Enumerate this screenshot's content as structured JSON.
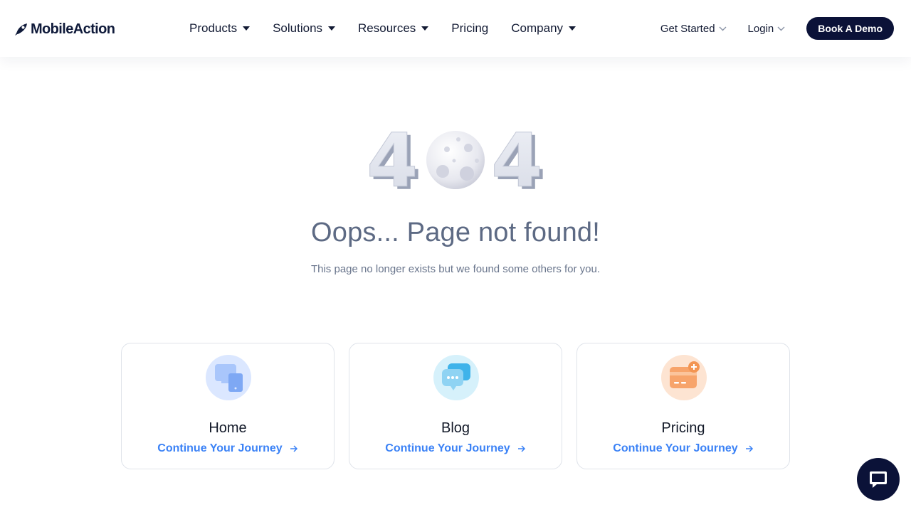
{
  "brand": {
    "name": "MobileAction"
  },
  "nav": {
    "items": [
      {
        "label": "Products",
        "has_dropdown": true
      },
      {
        "label": "Solutions",
        "has_dropdown": true
      },
      {
        "label": "Resources",
        "has_dropdown": true
      },
      {
        "label": "Pricing",
        "has_dropdown": false
      },
      {
        "label": "Company",
        "has_dropdown": true
      }
    ],
    "get_started": "Get Started",
    "login": "Login",
    "book_demo": "Book A Demo"
  },
  "error": {
    "code_left": "4",
    "code_right": "4",
    "title": "Oops... Page not found!",
    "message": "This page no longer exists but we found some others for you."
  },
  "cards": [
    {
      "title": "Home",
      "link": "Continue Your Journey",
      "icon": "devices-icon",
      "color": "#dbe7ff"
    },
    {
      "title": "Blog",
      "link": "Continue Your Journey",
      "icon": "chat-bubbles-icon",
      "color": "#d6f1fb"
    },
    {
      "title": "Pricing",
      "link": "Continue Your Journey",
      "icon": "credit-card-icon",
      "color": "#fde4d2"
    }
  ],
  "colors": {
    "accent": "#3b82f6",
    "dark": "#0b1238",
    "muted": "#5d6a84"
  }
}
